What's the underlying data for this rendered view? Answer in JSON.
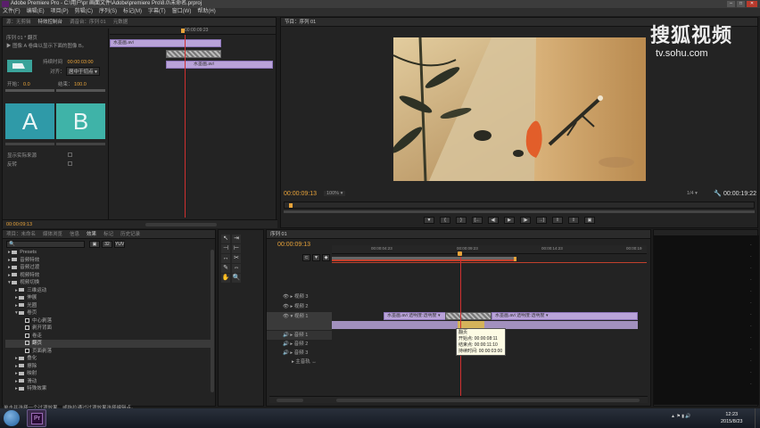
{
  "window": {
    "title": "Adobe Premiere Pro - C:\\用户\\pr 画面文件\\Adobe\\premiere Pro\\8.0\\未命名.prproj"
  },
  "menu": [
    "文件(F)",
    "编辑(E)",
    "项目(P)",
    "剪辑(C)",
    "序列(S)",
    "标记(M)",
    "字幕(T)",
    "窗口(W)",
    "帮助(H)"
  ],
  "effect_controls": {
    "tabs": [
      "源：无剪辑",
      "特效控制台",
      "调音台：序列 01",
      "元数据"
    ],
    "sequence": "序列 01 * 翻页",
    "clip_desc": "图像 A 卷曲以显示下面的图像 B。",
    "timeline_time": "00:00:09:23",
    "duration_label": "持续时间",
    "duration_value": "00:00:03:00",
    "alignment_label": "对齐：",
    "alignment_value": "居中于切点",
    "start_label": "开始：",
    "start_value": "0.0",
    "end_label": "结束：",
    "end_value": "100.0",
    "a_label": "A",
    "b_label": "B",
    "show_source_label": "显示实际来源",
    "reverse_label": "反转",
    "bottom_time": "00:00:09:13",
    "clip_a": "水墨画.avi",
    "clip_b": "水墨画.avi"
  },
  "program": {
    "tab": "节目：序列 01",
    "current_time": "00:00:09:13",
    "fit": "100%",
    "fraction": "1/4",
    "duration": "00:00:19:22",
    "watermark": "搜狐视频",
    "watermark_url": "tv.sohu.com"
  },
  "project": {
    "tabs": [
      "项目：未命名",
      "媒体浏览",
      "信息",
      "效果",
      "标记",
      "历史记录"
    ],
    "tree": [
      {
        "label": "Presets",
        "level": 1,
        "kind": "folder"
      },
      {
        "label": "音频特效",
        "level": 1,
        "kind": "folder"
      },
      {
        "label": "音频过渡",
        "level": 1,
        "kind": "folder"
      },
      {
        "label": "视频特效",
        "level": 1,
        "kind": "folder"
      },
      {
        "label": "视频切换",
        "level": 1,
        "kind": "folder",
        "open": true
      },
      {
        "label": "三维运动",
        "level": 2,
        "kind": "folder"
      },
      {
        "label": "伸展",
        "level": 2,
        "kind": "folder"
      },
      {
        "label": "光圈",
        "level": 2,
        "kind": "folder"
      },
      {
        "label": "卷页",
        "level": 2,
        "kind": "folder",
        "open": true
      },
      {
        "label": "中心剥落",
        "level": 3,
        "kind": "fx"
      },
      {
        "label": "剥开背面",
        "level": 3,
        "kind": "fx"
      },
      {
        "label": "卷走",
        "level": 3,
        "kind": "fx"
      },
      {
        "label": "翻页",
        "level": 3,
        "kind": "fx",
        "selected": true
      },
      {
        "label": "页面剥落",
        "level": 3,
        "kind": "fx"
      },
      {
        "label": "叠化",
        "level": 2,
        "kind": "folder"
      },
      {
        "label": "擦除",
        "level": 2,
        "kind": "folder"
      },
      {
        "label": "映射",
        "level": 2,
        "kind": "folder"
      },
      {
        "label": "滑动",
        "level": 2,
        "kind": "folder"
      },
      {
        "label": "特殊效果",
        "level": 2,
        "kind": "folder"
      }
    ]
  },
  "timeline": {
    "tab": "序列 01",
    "current_time": "00:00:09:13",
    "ruler": [
      "00:00:04:23",
      "00:00:09:23",
      "00:00:14:23",
      "00:00:19"
    ],
    "tracks": {
      "v3": "视频 3",
      "v2": "视频 2",
      "v1": "视频 1",
      "a1": "音频 1",
      "a2": "音频 2",
      "a3": "音频 3",
      "master": "主音轨"
    },
    "clip1": "水墨画.avi 透明度:透明度 ▾",
    "clip2": "水墨画.avi 透明度:透明度 ▾"
  },
  "tooltip": {
    "title": "翻页",
    "start": "开始点: 00:00:08:11",
    "end": "结束点: 00:00:11:10",
    "duration": "持续时间: 00:00:03:00"
  },
  "status": "单击并选择一个过渡效果，或拖拉通过过渡效果选择编辑点。",
  "taskbar": {
    "time": "12:23",
    "date": "2015/8/23"
  },
  "colors": {
    "accent": "#e8a33a",
    "clip": "#b9a3d9",
    "playhead": "#d03030",
    "transition_a": "#2f9aa8",
    "transition_b": "#3fb3a8"
  },
  "icons": [
    "windows-start-icon",
    "premiere-taskbar-icon",
    "play-icon",
    "step-back-icon",
    "step-forward-icon",
    "selection-tool-icon",
    "razor-tool-icon",
    "hand-tool-icon",
    "zoom-tool-icon"
  ]
}
